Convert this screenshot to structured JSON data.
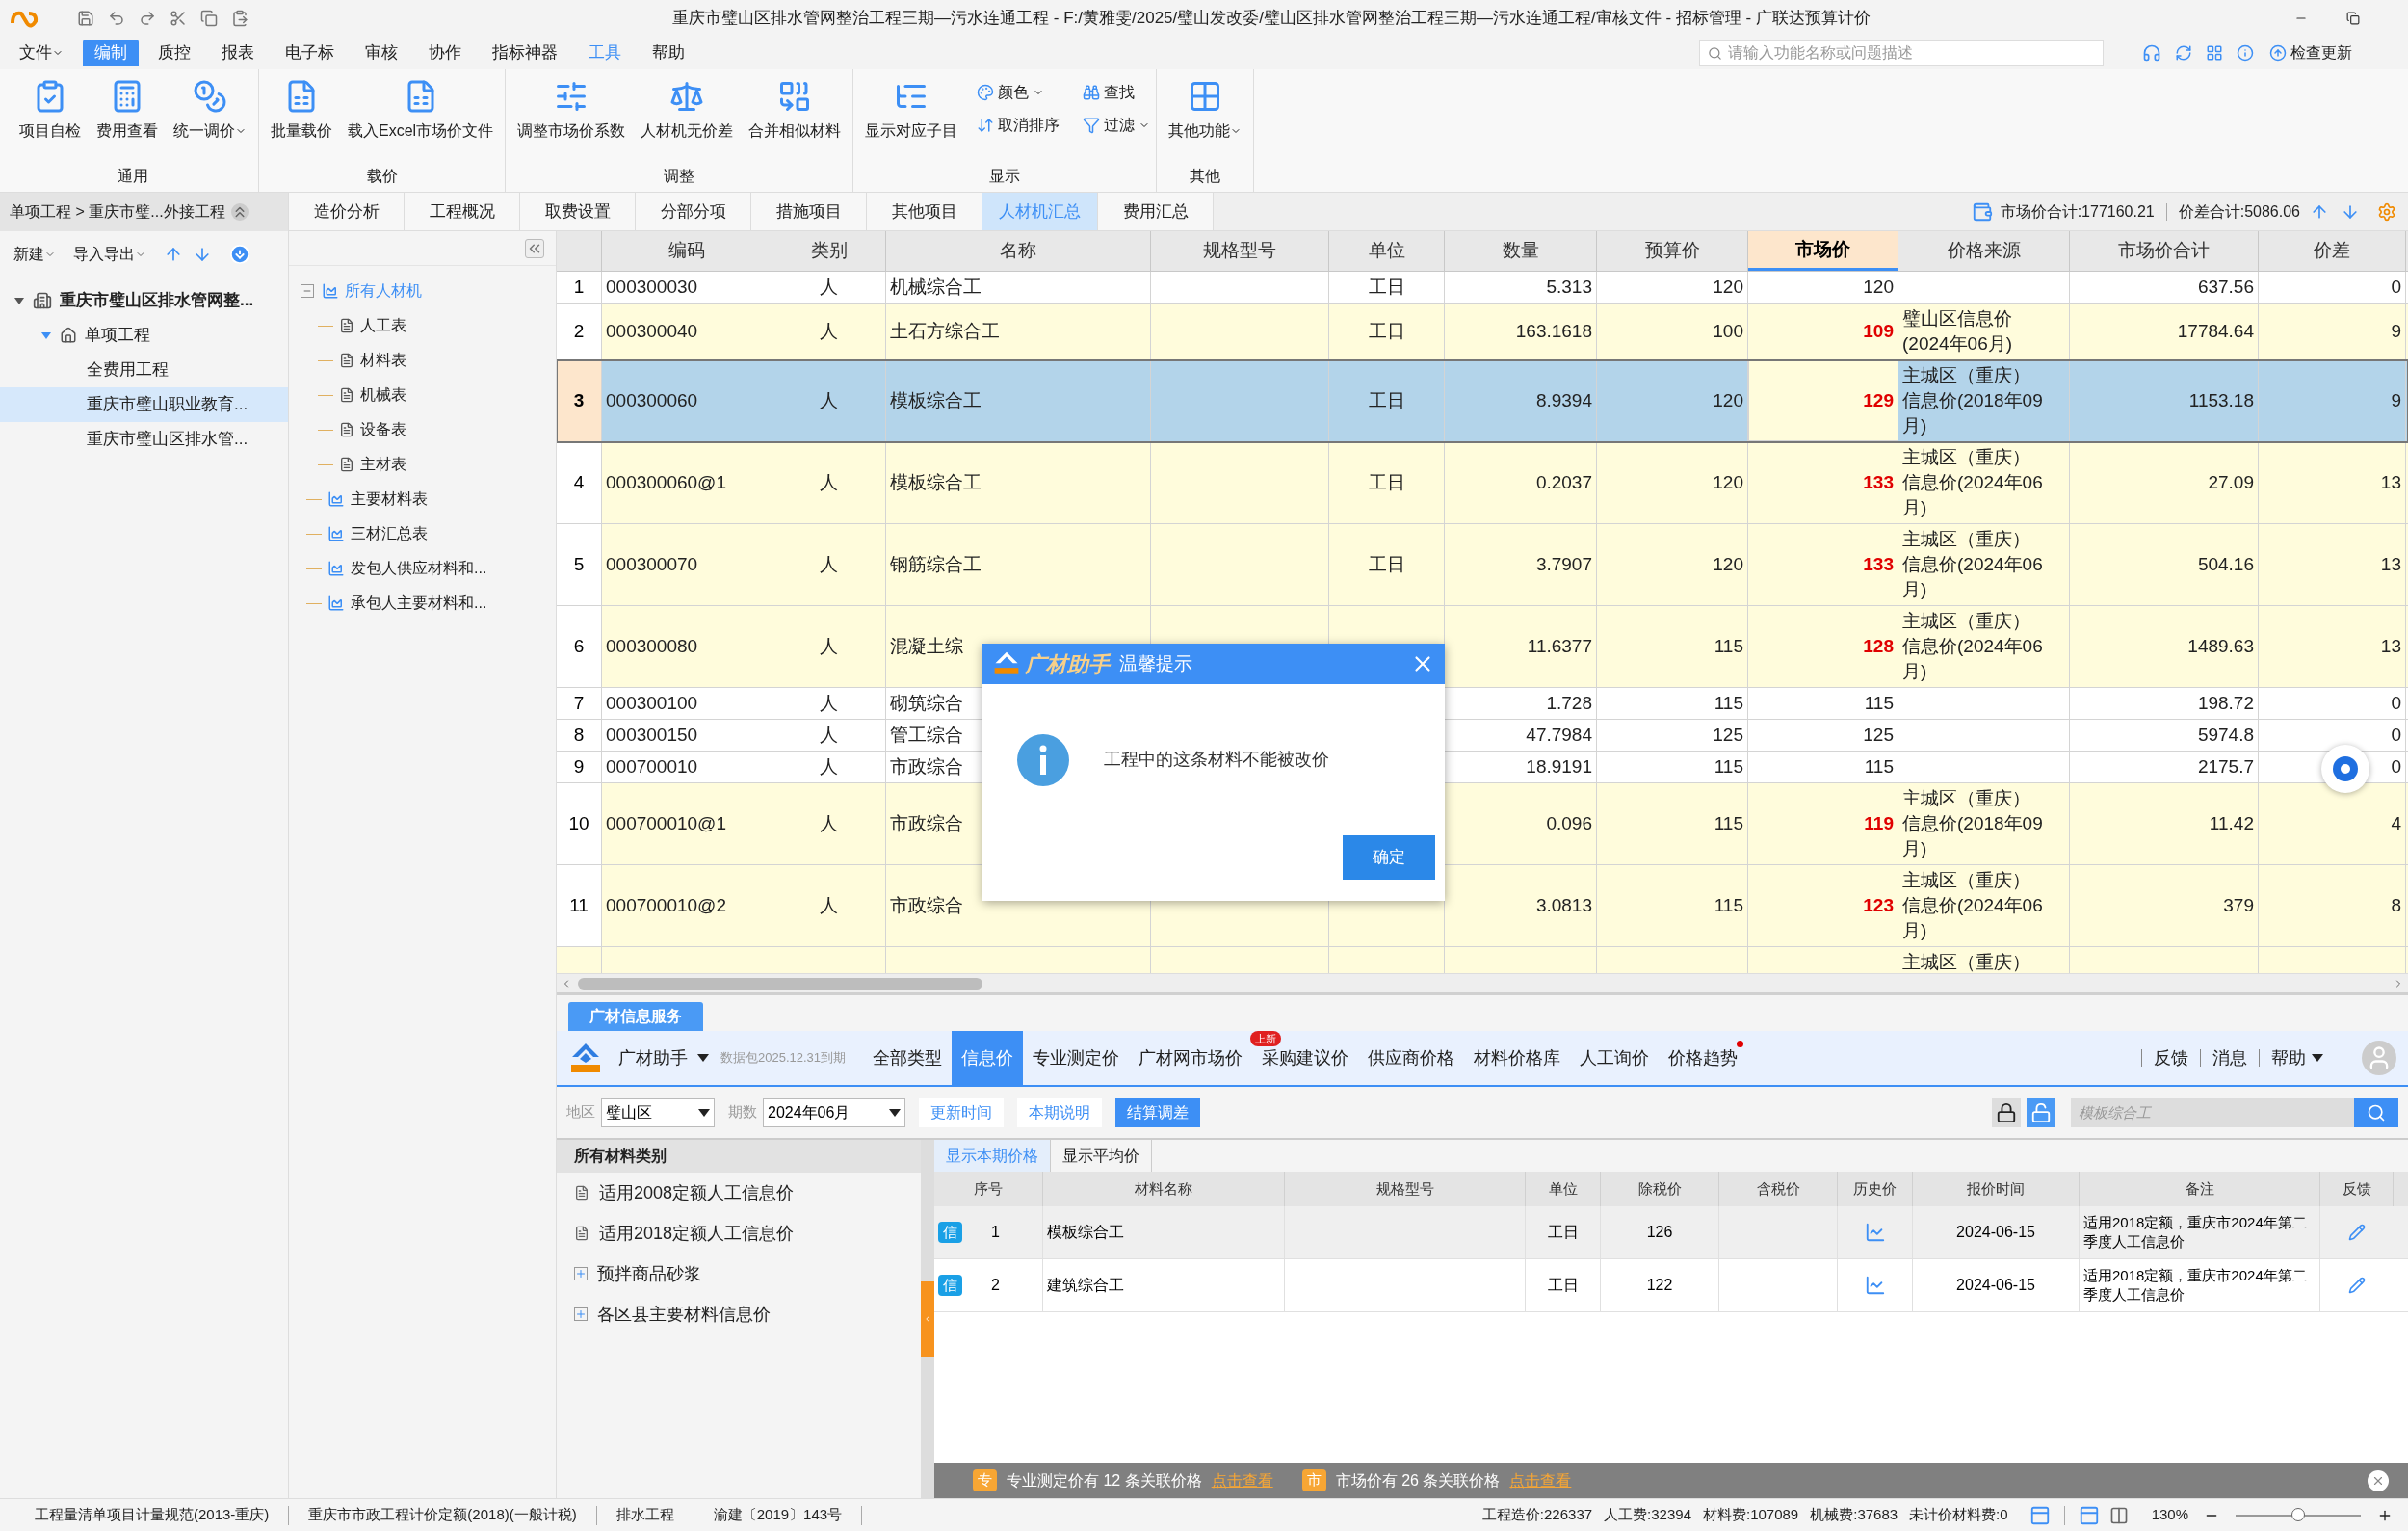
{
  "window": {
    "title": "重庆市璧山区排水管网整治工程三期—污水连通工程 - F:/黄雅雯/2025/璧山发改委/璧山区排水管网整治工程三期—污水连通工程/审核文件 - 招标管理 - 广联达预算计价"
  },
  "menu": [
    {
      "label": "文件",
      "selected": false,
      "accent": false,
      "dropdown": true
    },
    {
      "label": "编制",
      "selected": true,
      "accent": false,
      "dropdown": false
    },
    {
      "label": "质控",
      "selected": false,
      "accent": false,
      "dropdown": false
    },
    {
      "label": "报表",
      "selected": false,
      "accent": false,
      "dropdown": false
    },
    {
      "label": "电子标",
      "selected": false,
      "accent": false,
      "dropdown": false
    },
    {
      "label": "审核",
      "selected": false,
      "accent": false,
      "dropdown": false
    },
    {
      "label": "协作",
      "selected": false,
      "accent": false,
      "dropdown": false
    },
    {
      "label": "指标神器",
      "selected": false,
      "accent": false,
      "dropdown": false
    },
    {
      "label": "工具",
      "selected": false,
      "accent": true,
      "dropdown": false
    },
    {
      "label": "帮助",
      "selected": false,
      "accent": false,
      "dropdown": false
    }
  ],
  "search": {
    "placeholder": "请输入功能名称或问题描述"
  },
  "update_button": "检查更新",
  "ribbon": [
    {
      "label": "通用",
      "items": [
        {
          "label": "项目自检",
          "kind": "large",
          "dropdown": false
        },
        {
          "label": "费用查看",
          "kind": "large",
          "dropdown": false
        },
        {
          "label": "统一调价",
          "kind": "large",
          "dropdown": true
        }
      ]
    },
    {
      "label": "载价",
      "items": [
        {
          "label": "批量载价",
          "kind": "large",
          "dropdown": false
        },
        {
          "label": "载入Excel市场价文件",
          "kind": "large",
          "dropdown": false
        }
      ]
    },
    {
      "label": "调整",
      "items": [
        {
          "label": "调整市场价系数",
          "kind": "large",
          "dropdown": false
        },
        {
          "label": "人材机无价差",
          "kind": "large",
          "dropdown": false
        },
        {
          "label": "合并相似材料",
          "kind": "large",
          "dropdown": false
        }
      ]
    },
    {
      "label": "显示",
      "items": [
        {
          "label": "显示对应子目",
          "kind": "large",
          "dropdown": false
        },
        {
          "label": "颜色",
          "kind": "small",
          "dropdown": true
        },
        {
          "label": "取消排序",
          "kind": "small",
          "dropdown": false
        },
        {
          "label": "查找",
          "kind": "small",
          "dropdown": false
        },
        {
          "label": "过滤",
          "kind": "small",
          "dropdown": true
        }
      ]
    },
    {
      "label": "其他",
      "items": [
        {
          "label": "其他功能",
          "kind": "large",
          "dropdown": true
        }
      ]
    }
  ],
  "breadcrumb": "单项工程 > 重庆市璧...外接工程",
  "left_toolbar": [
    {
      "label": "新建",
      "dropdown": true
    },
    {
      "label": "导入导出",
      "dropdown": true
    }
  ],
  "project_tree": [
    {
      "label": "重庆市璧山区排水管网整...",
      "selected": false,
      "expanded": true,
      "children": [
        {
          "label": "单项工程",
          "selected": false,
          "expanded": true,
          "children": [
            {
              "label": "全费用工程",
              "selected": false
            },
            {
              "label": "重庆市璧山职业教育...",
              "selected": true
            },
            {
              "label": "重庆市璧山区排水管...",
              "selected": false
            }
          ]
        }
      ]
    }
  ],
  "tabs": [
    {
      "label": "造价分析",
      "selected": false
    },
    {
      "label": "工程概况",
      "selected": false
    },
    {
      "label": "取费设置",
      "selected": false
    },
    {
      "label": "分部分项",
      "selected": false
    },
    {
      "label": "措施项目",
      "selected": false
    },
    {
      "label": "其他项目",
      "selected": false
    },
    {
      "label": "人材机汇总",
      "selected": true
    },
    {
      "label": "费用汇总",
      "selected": false
    }
  ],
  "totals": [
    {
      "text": "市场价合计:177160.21"
    },
    {
      "text": "价差合计:5086.06"
    }
  ],
  "material_tree": [
    {
      "label": "所有人材机",
      "selected": true,
      "expanded": true,
      "children": [
        {
          "label": "人工表",
          "selected": false
        },
        {
          "label": "材料表",
          "selected": false
        },
        {
          "label": "机械表",
          "selected": false
        },
        {
          "label": "设备表",
          "selected": false
        },
        {
          "label": "主材表",
          "selected": false
        }
      ]
    },
    {
      "label": "主要材料表",
      "selected": false
    },
    {
      "label": "三材汇总表",
      "selected": false
    },
    {
      "label": "发包人供应材料和...",
      "selected": false
    },
    {
      "label": "承包人主要材料和...",
      "selected": false
    }
  ],
  "table": {
    "columns": [
      {
        "label": "编码",
        "selected": false
      },
      {
        "label": "类别",
        "selected": false
      },
      {
        "label": "名称",
        "selected": false
      },
      {
        "label": "规格型号",
        "selected": false
      },
      {
        "label": "单位",
        "selected": false
      },
      {
        "label": "数量",
        "selected": false
      },
      {
        "label": "预算价",
        "selected": false
      },
      {
        "label": "市场价",
        "selected": true
      },
      {
        "label": "价格来源",
        "selected": false
      },
      {
        "label": "市场价合计",
        "selected": false
      },
      {
        "label": "价差",
        "selected": false
      }
    ],
    "rows": [
      {
        "no": "1",
        "code": "000300030",
        "category": "人",
        "name": "机械综合工",
        "unit": "工日",
        "quantity": "5.313",
        "budget_price": "120",
        "market_price": "120",
        "price_changed": false,
        "market_total": "637.56",
        "price_diff": "0",
        "selected": false
      },
      {
        "no": "2",
        "code": "000300040",
        "category": "人",
        "name": "土石方综合工",
        "unit": "工日",
        "quantity": "163.1618",
        "budget_price": "100",
        "market_price": "109",
        "price_changed": true,
        "price_source": "璧山区信息价(2024年06月)",
        "market_total": "17784.64",
        "price_diff": "9",
        "selected": false
      },
      {
        "no": "3",
        "code": "000300060",
        "category": "人",
        "name": "模板综合工",
        "unit": "工日",
        "quantity": "8.9394",
        "budget_price": "120",
        "market_price": "129",
        "price_changed": true,
        "price_source": "主城区（重庆）信息价(2018年09月)",
        "market_total": "1153.18",
        "price_diff": "9",
        "selected": true
      },
      {
        "no": "4",
        "code": "000300060@1",
        "category": "人",
        "name": "模板综合工",
        "unit": "工日",
        "quantity": "0.2037",
        "budget_price": "120",
        "market_price": "133",
        "price_changed": true,
        "price_source": "主城区（重庆）信息价(2024年06月)",
        "market_total": "27.09",
        "price_diff": "13",
        "selected": false
      },
      {
        "no": "5",
        "code": "000300070",
        "category": "人",
        "name": "钢筋综合工",
        "unit": "工日",
        "quantity": "3.7907",
        "budget_price": "120",
        "market_price": "133",
        "price_changed": true,
        "price_source": "主城区（重庆）信息价(2024年06月)",
        "market_total": "504.16",
        "price_diff": "13",
        "selected": false
      },
      {
        "no": "6",
        "code": "000300080",
        "category": "人",
        "name": "混凝土综",
        "quantity": "11.6377",
        "budget_price": "115",
        "market_price": "128",
        "price_changed": true,
        "price_source": "主城区（重庆）信息价(2024年06月)",
        "market_total": "1489.63",
        "price_diff": "13",
        "selected": false
      },
      {
        "no": "7",
        "code": "000300100",
        "category": "人",
        "name": "砌筑综合",
        "quantity": "1.728",
        "budget_price": "115",
        "market_price": "115",
        "price_changed": false,
        "market_total": "198.72",
        "price_diff": "0",
        "selected": false
      },
      {
        "no": "8",
        "code": "000300150",
        "category": "人",
        "name": "管工综合",
        "quantity": "47.7984",
        "budget_price": "125",
        "market_price": "125",
        "price_changed": false,
        "market_total": "5974.8",
        "price_diff": "0",
        "selected": false
      },
      {
        "no": "9",
        "code": "000700010",
        "category": "人",
        "name": "市政综合",
        "quantity": "18.9191",
        "budget_price": "115",
        "market_price": "115",
        "price_changed": false,
        "market_total": "2175.7",
        "price_diff": "0",
        "selected": false
      },
      {
        "no": "10",
        "code": "000700010@1",
        "category": "人",
        "name": "市政综合",
        "quantity": "0.096",
        "budget_price": "115",
        "market_price": "119",
        "price_changed": true,
        "price_source": "主城区（重庆）信息价(2018年09月)",
        "market_total": "11.42",
        "price_diff": "4",
        "selected": false
      },
      {
        "no": "11",
        "code": "000700010@2",
        "category": "人",
        "name": "市政综合",
        "quantity": "3.0813",
        "budget_price": "115",
        "market_price": "123",
        "price_changed": true,
        "price_source": "主城区（重庆）信息价(2024年06月)",
        "market_total": "379",
        "price_diff": "8",
        "selected": false
      },
      {
        "price_changed": true,
        "price_source": "主城区（重庆）",
        "selected": false
      }
    ]
  },
  "dialog": {
    "logo_text": "广材助手",
    "title": "温馨提示",
    "message": "工程中的这条材料不能被改价",
    "ok_button": "确定"
  },
  "info_panel": {
    "tab": "广材信息服务",
    "brand": "广材助手",
    "package_note": "数据包2025.12.31到期",
    "tabs": [
      {
        "label": "全部类型",
        "selected": false
      },
      {
        "label": "信息价",
        "selected": true
      },
      {
        "label": "专业测定价",
        "selected": false
      },
      {
        "label": "广材网市场价",
        "selected": false
      },
      {
        "label": "采购建议价",
        "selected": false,
        "badge": "上新"
      },
      {
        "label": "供应商价格",
        "selected": false
      },
      {
        "label": "材料价格库",
        "selected": false
      },
      {
        "label": "人工询价",
        "selected": false
      },
      {
        "label": "价格趋势",
        "selected": false,
        "dot": true
      }
    ],
    "links": [
      {
        "label": "反馈",
        "dropdown": false
      },
      {
        "label": "消息",
        "dropdown": false
      },
      {
        "label": "帮助",
        "dropdown": true
      }
    ],
    "region_label": "地区",
    "region": "璧山区",
    "period_label": "期数",
    "period": "2024年06月",
    "buttons": [
      {
        "label": "更新时间",
        "kind": "outline"
      },
      {
        "label": "本期说明",
        "kind": "outline"
      },
      {
        "label": "结算调差",
        "kind": "filled"
      }
    ],
    "search": {
      "placeholder": "模板综合工"
    },
    "categories_header": "所有材料类别",
    "categories": [
      {
        "label": "适用2008定额人工信息价",
        "kind": "leaf"
      },
      {
        "label": "适用2018定额人工信息价",
        "kind": "leaf"
      },
      {
        "label": "预拌商品砂浆",
        "kind": "group"
      },
      {
        "label": "各区县主要材料信息价",
        "kind": "group"
      }
    ],
    "view_tabs": [
      {
        "label": "显示本期价格",
        "selected": true
      },
      {
        "label": "显示平均价",
        "selected": false
      }
    ],
    "columns": [
      "序号",
      "材料名称",
      "规格型号",
      "单位",
      "除税价",
      "含税价",
      "历史价",
      "报价时间",
      "备注",
      "反馈"
    ],
    "rows": [
      {
        "tag": "信",
        "no": "1",
        "name": "模板综合工",
        "unit": "工日",
        "price_ex_tax": "126",
        "quote_date": "2024-06-15",
        "remark": "适用2018定额，重庆市2024年第二季度人工信息价",
        "selected": true
      },
      {
        "tag": "信",
        "no": "2",
        "name": "建筑综合工",
        "unit": "工日",
        "price_ex_tax": "122",
        "quote_date": "2024-06-15",
        "remark": "适用2018定额，重庆市2024年第二季度人工信息价",
        "selected": false
      }
    ],
    "notices": [
      {
        "tag": "专",
        "text": "专业测定价有 12 条关联价格",
        "link": "点击查看"
      },
      {
        "tag": "市",
        "text": "市场价有 26 条关联价格",
        "link": "点击查看"
      }
    ]
  },
  "status_bar": {
    "items": [
      "工程量清单项目计量规范(2013-重庆)",
      "重庆市市政工程计价定额(2018)(一般计税)",
      "排水工程",
      "渝建〔2019〕143号"
    ],
    "costs": [
      "工程造价:226337",
      "人工费:32394",
      "材料费:107089",
      "机械费:37683",
      "未计价材料费:0"
    ],
    "zoom": "130%",
    "level": 0.5
  }
}
